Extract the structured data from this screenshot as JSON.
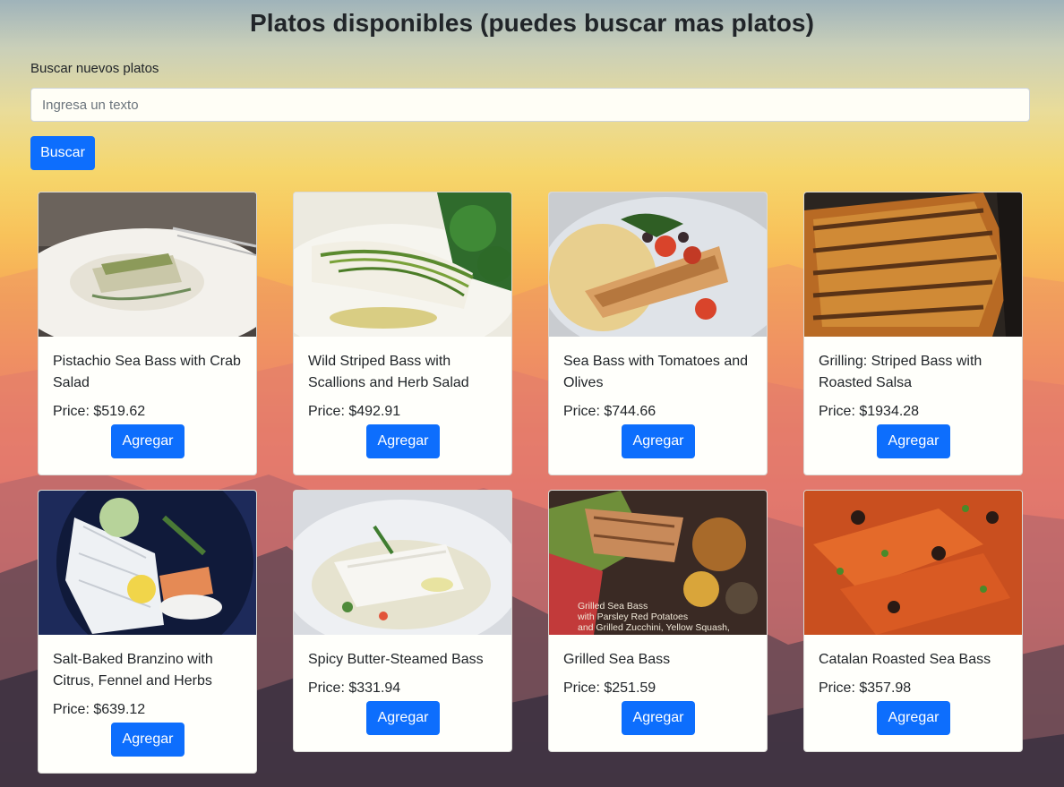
{
  "header": {
    "title": "Platos disponibles (puedes buscar mas platos)"
  },
  "search": {
    "label": "Buscar nuevos platos",
    "placeholder": "Ingresa un texto",
    "value": "",
    "button_label": "Buscar"
  },
  "price_prefix": "Price: ",
  "add_label": "Agregar",
  "dishes": [
    {
      "title": "Pistachio Sea Bass with Crab Salad",
      "price": "Price: $519.62",
      "image": "plated-fish-pistachio"
    },
    {
      "title": "Wild Striped Bass with Scallions and Herb Salad",
      "price": "Price: $492.91",
      "image": "plated-fish-scallions"
    },
    {
      "title": "Sea Bass with Tomatoes and Olives",
      "price": "Price: $744.66",
      "image": "plated-fish-tomatoes"
    },
    {
      "title": "Grilling: Striped Bass with Roasted Salsa",
      "price": "Price: $1934.28",
      "image": "grilled-fish"
    },
    {
      "title": "Salt-Baked Branzino with Citrus, Fennel and Herbs",
      "price": "Price: $639.12",
      "image": "plated-fish-citrus"
    },
    {
      "title": "Spicy Butter-Steamed Bass",
      "price": "Price: $331.94",
      "image": "fish-in-broth"
    },
    {
      "title": "Grilled Sea Bass",
      "price": "Price: $251.59",
      "image": "grilled-sea-bass-photo"
    },
    {
      "title": "Catalan Roasted Sea Bass",
      "price": "Price: $357.98",
      "image": "fish-in-tomato-sauce"
    }
  ],
  "image_caption_3_2": [
    "Grilled Sea Bass",
    "with Parsley Red Potatoes",
    "and Grilled Zucchini, Yellow Squash,"
  ],
  "colors": {
    "accent": "#0d6efd",
    "card_bg": "#fffffb"
  }
}
